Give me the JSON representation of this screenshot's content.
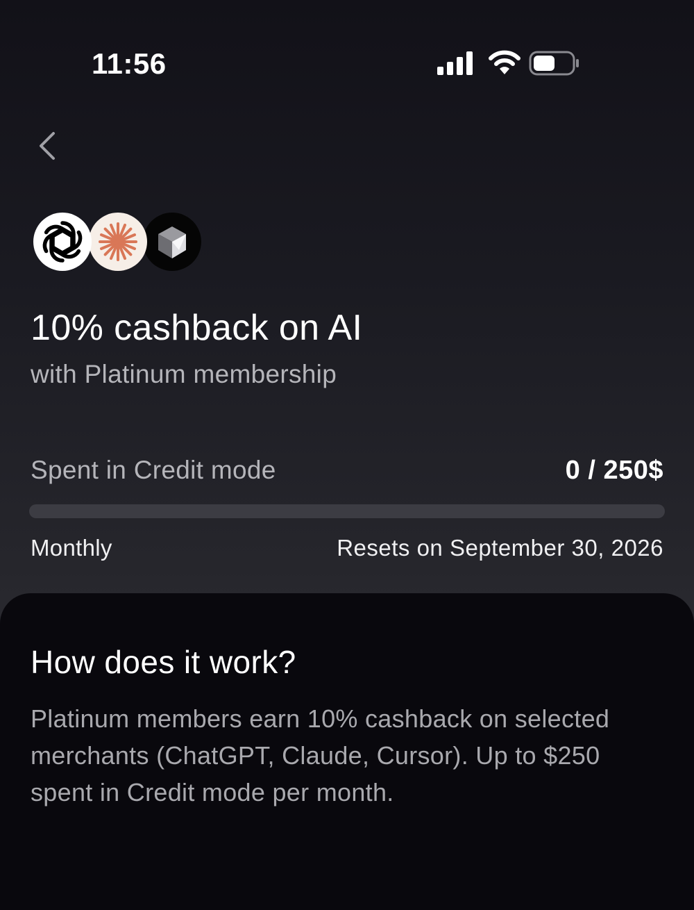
{
  "status_bar": {
    "time": "11:56",
    "icons": [
      "signal-icon",
      "wifi-icon",
      "battery-icon"
    ]
  },
  "header": {
    "back_icon": "chevron-left-icon"
  },
  "merchants": [
    {
      "name": "ChatGPT",
      "icon": "openai-logo-icon"
    },
    {
      "name": "Claude",
      "icon": "claude-logo-icon"
    },
    {
      "name": "Cursor",
      "icon": "cursor-logo-icon"
    }
  ],
  "offer": {
    "title": "10% cashback on AI",
    "subtitle": "with Platinum membership"
  },
  "spending": {
    "label": "Spent in Credit mode",
    "value": "0 / 250$",
    "spent": 0,
    "limit": 250,
    "progress_fraction": 0,
    "period": "Monthly",
    "reset_text": "Resets on September 30, 2026"
  },
  "info": {
    "title": "How does it work?",
    "body": "Platinum members earn 10% cashback on selected merchants (ChatGPT, Claude, Cursor). Up to $250 spent in Credit mode per month."
  },
  "colors": {
    "background_top": "#121118",
    "background_mid": "#2a2a30",
    "sheet": "#09080d",
    "progress_track": "#3c3c43",
    "claude_accent": "#d97757"
  }
}
